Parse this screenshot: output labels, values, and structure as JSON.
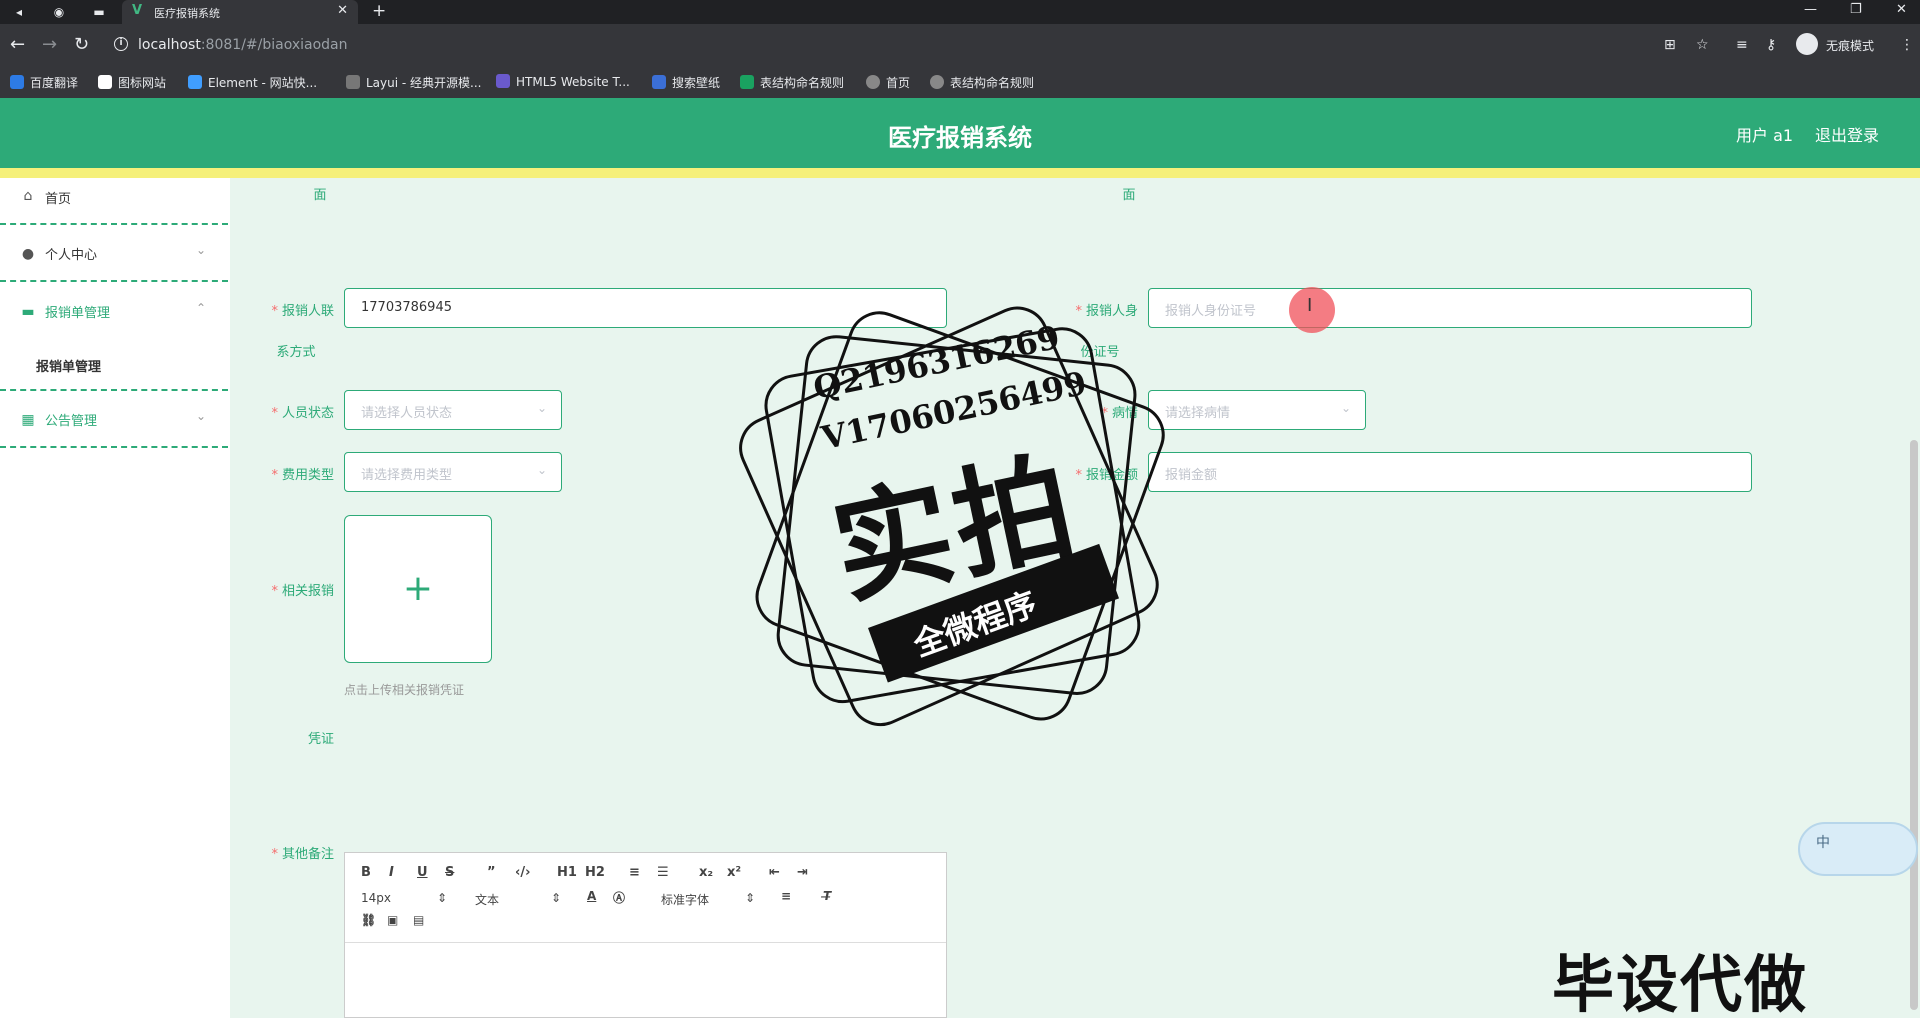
{
  "browser": {
    "tab_title": "医疗报销系统",
    "tab_favicon": "V",
    "url_host": "localhost",
    "url_rest": ":8081/#/biaoxiaodan",
    "incognito_label": "无痕模式",
    "bookmarks": [
      {
        "label": "百度翻译",
        "color": "#2d7be5"
      },
      {
        "label": "图标网站",
        "color": "#ffffff"
      },
      {
        "label": "Element - 网站快...",
        "color": "#409eff"
      },
      {
        "label": "Layui - 经典开源模...",
        "color": "#e8eaed"
      },
      {
        "label": "HTML5 Website T...",
        "color": "#6a5acd"
      },
      {
        "label": "搜索壁纸",
        "color": "#3b6fd6"
      },
      {
        "label": "表结构命名规则",
        "color": "#1aa260"
      },
      {
        "label": "首页",
        "color": "#e8eaed"
      },
      {
        "label": "表结构命名规则",
        "color": "#e8eaed"
      }
    ]
  },
  "header": {
    "title": "医疗报销系统",
    "user": "用户 a1",
    "logout": "退出登录"
  },
  "sidebar": {
    "items": [
      {
        "label": "首页",
        "icon": "home-icon"
      },
      {
        "label": "个人中心",
        "icon": "user-icon"
      },
      {
        "label": "报销单管理",
        "icon": "briefcase-icon"
      },
      {
        "label": "公告管理",
        "icon": "grid-icon"
      }
    ],
    "sub_item": "报销单管理"
  },
  "form": {
    "top_label_left": "面",
    "top_label_right": "面",
    "phone_label_1": "报销人联",
    "phone_label_2": "系方式",
    "phone_value": "17703786945",
    "idcard_label_1": "报销人身",
    "idcard_label_2": "份证号",
    "idcard_placeholder": "报销人身份证号",
    "status_label": "人员状态",
    "status_placeholder": "请选择人员状态",
    "disease_label": "病情",
    "disease_placeholder": "请选择病情",
    "fee_type_label": "费用类型",
    "fee_type_placeholder": "请选择费用类型",
    "amount_label": "报销金额",
    "amount_placeholder": "报销金额",
    "voucher_label_1": "相关报销",
    "voucher_label_2": "凭证",
    "upload_tip": "点击上传相关报销凭证",
    "remark_label": "其他备注"
  },
  "editor": {
    "buttons_row1": [
      "B",
      "I",
      "U",
      "S",
      "”",
      "‹/›",
      "H1",
      "H2",
      "≡",
      "☰",
      "x₂",
      "x²",
      "⇤",
      "⇥"
    ],
    "font_size": "14px",
    "text_type": "文本",
    "font_family": "标准字体"
  },
  "ime": {
    "label": "中"
  },
  "watermark": {
    "qq": "Q2196316269",
    "vx": "V17060256499",
    "big": "实拍",
    "banner": "全微程序",
    "corner": "毕设代做"
  },
  "colors": {
    "primary": "#2daa78",
    "strip": "#f5f07a",
    "required": "#f56c6c"
  }
}
